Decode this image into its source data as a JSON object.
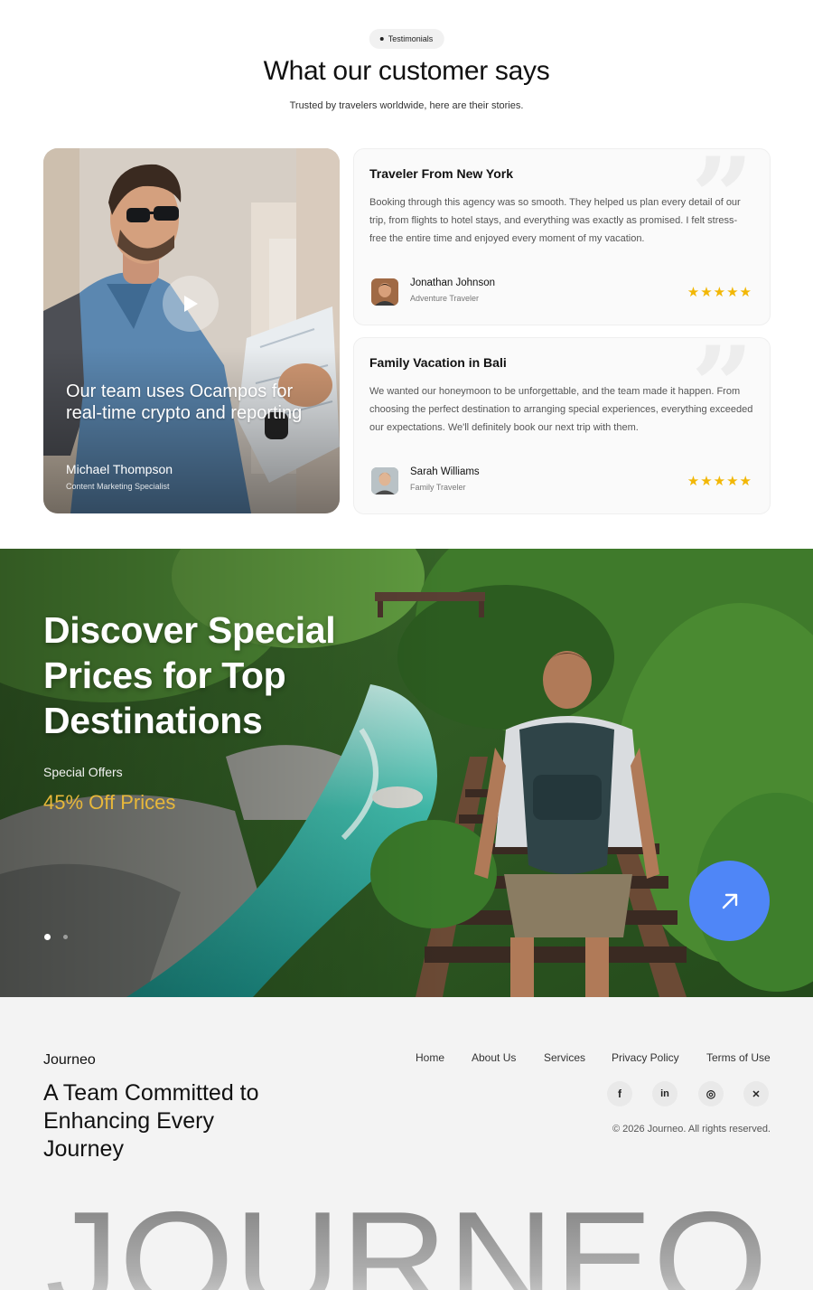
{
  "testimonials": {
    "badge": "Testimonials",
    "title": "What our customer says",
    "subtitle": "Trusted by travelers worldwide, here are their stories.",
    "video_card": {
      "quote": "Our team uses Ocampos for real-time crypto and reporting",
      "name": "Michael Thompson",
      "role": "Content Marketing Specialist"
    },
    "cards": [
      {
        "title": "Traveler From New York",
        "body": "Booking through this agency was so smooth. They helped us plan every detail of our trip, from flights to hotel stays, and everything was exactly as promised. I felt stress-free the entire time and enjoyed every moment of my vacation.",
        "name": "Jonathan Johnson",
        "role": "Adventure Traveler",
        "rating": 5,
        "stars": "★★★★★"
      },
      {
        "title": "Family Vacation in Bali",
        "body": "We wanted our honeymoon to be unforgettable, and the team made it happen. From choosing the perfect destination to arranging special experiences, everything exceeded our expectations. We'll definitely book our next trip with them.",
        "name": "Sarah Williams",
        "role": "Family Traveler",
        "rating": 5,
        "stars": "★★★★★"
      }
    ]
  },
  "hero": {
    "title": "Discover Special Prices for Top Destinations",
    "label": "Special Offers",
    "offer": "45% Off Prices",
    "cta_icon": "arrow-up-right-icon",
    "offer_color": "#e8b83a",
    "cta_color": "#4f86f7",
    "slides": 2,
    "active_slide": 1
  },
  "footer": {
    "brand": "Journeo",
    "tagline": "A Team Committed to Enhancing Every Journey",
    "nav": [
      "Home",
      "About Us",
      "Services",
      "Privacy Policy",
      "Terms of Use"
    ],
    "social": [
      {
        "icon": "facebook-icon",
        "glyph": "f"
      },
      {
        "icon": "linkedin-icon",
        "glyph": "in"
      },
      {
        "icon": "instagram-icon",
        "glyph": "◎"
      },
      {
        "icon": "twitter-icon",
        "glyph": "✕"
      }
    ],
    "copyright": "© 2026 Journeo. All rights reserved.",
    "wordmark": "JOURNEO"
  }
}
